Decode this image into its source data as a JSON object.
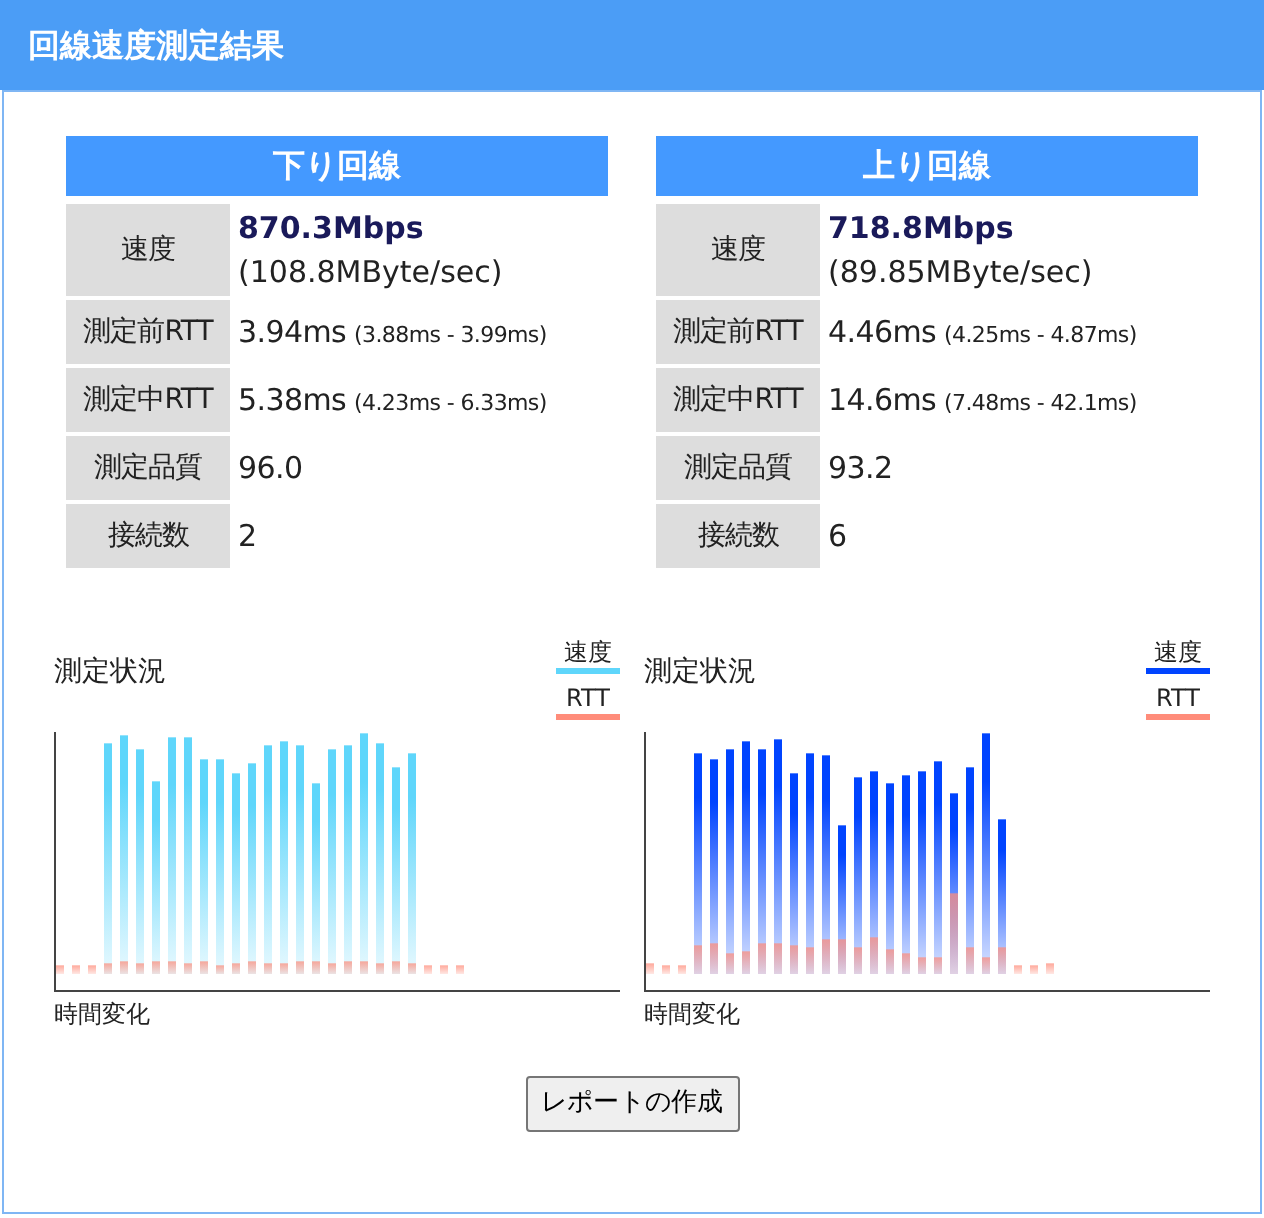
{
  "header": {
    "title": "回線速度測定結果"
  },
  "panels": [
    {
      "heading": "下り回線",
      "rows": [
        {
          "kind": "speed",
          "label": "速度",
          "value": "870.3Mbps",
          "sub": "(108.8MByte/sec)"
        },
        {
          "kind": "rtt",
          "label": "測定前RTT",
          "value": "3.94ms",
          "range": "(3.88ms - 3.99ms)"
        },
        {
          "kind": "rtt",
          "label": "測定中RTT",
          "value": "5.38ms",
          "range": "(4.23ms - 6.33ms)"
        },
        {
          "kind": "plain",
          "label": "測定品質",
          "value": "96.0"
        },
        {
          "kind": "plain",
          "label": "接続数",
          "value": "2"
        }
      ],
      "chart": {
        "title": "測定状況",
        "xlabel": "時間変化",
        "legend": [
          {
            "label": "速度",
            "color": "#5fd6fb"
          },
          {
            "label": "RTT",
            "color": "#ff8c7a"
          }
        ]
      }
    },
    {
      "heading": "上り回線",
      "rows": [
        {
          "kind": "speed",
          "label": "速度",
          "value": "718.8Mbps",
          "sub": "(89.85MByte/sec)"
        },
        {
          "kind": "rtt",
          "label": "測定前RTT",
          "value": "4.46ms",
          "range": "(4.25ms - 4.87ms)"
        },
        {
          "kind": "rtt",
          "label": "測定中RTT",
          "value": "14.6ms",
          "range": "(7.48ms - 42.1ms)"
        },
        {
          "kind": "plain",
          "label": "測定品質",
          "value": "93.2"
        },
        {
          "kind": "plain",
          "label": "接続数",
          "value": "6"
        }
      ],
      "chart": {
        "title": "測定状況",
        "xlabel": "時間変化",
        "legend": [
          {
            "label": "速度",
            "color": "#0044ff"
          },
          {
            "label": "RTT",
            "color": "#ff8c7a"
          }
        ]
      }
    }
  ],
  "button": "レポートの作成"
}
